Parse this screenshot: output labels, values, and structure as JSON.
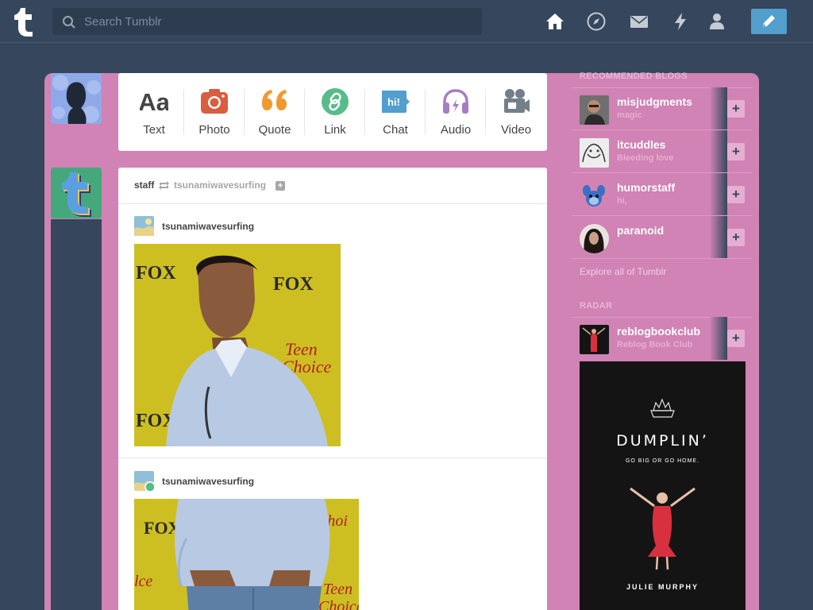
{
  "topbar": {
    "search_placeholder": "Search Tumblr",
    "nav_icons": [
      "home-icon",
      "compass-icon",
      "mail-icon",
      "lightning-icon",
      "account-icon"
    ],
    "compose_icon": "pencil-icon"
  },
  "colors": {
    "background": "#36465d",
    "frame_pink": "#d083b4",
    "accent_blue": "#529ecc"
  },
  "post_types": [
    {
      "label": "Text",
      "icon": "text-aa-icon",
      "color": "#444444"
    },
    {
      "label": "Photo",
      "icon": "camera-icon",
      "color": "#d95e40"
    },
    {
      "label": "Quote",
      "icon": "quote-icon",
      "color": "#f2992e"
    },
    {
      "label": "Link",
      "icon": "link-icon",
      "color": "#56bc8a"
    },
    {
      "label": "Chat",
      "icon": "chat-icon",
      "color": "#529ecc"
    },
    {
      "label": "Audio",
      "icon": "headphones-icon",
      "color": "#a77dc2"
    },
    {
      "label": "Video",
      "icon": "video-camera-icon",
      "color": "#748089"
    }
  ],
  "post": {
    "reblogger": "staff",
    "source": "tsunamiwavesurfing",
    "entries": [
      {
        "name": "tsunamiwavesurfing"
      },
      {
        "name": "tsunamiwavesurfing"
      }
    ]
  },
  "sidebar": {
    "recommended_heading": "RECOMMENDED BLOGS",
    "blogs": [
      {
        "name": "misjudgments",
        "subtitle": "magic"
      },
      {
        "name": "itcuddles",
        "subtitle": "Bleeding love"
      },
      {
        "name": "humorstaff",
        "subtitle": "hi,"
      },
      {
        "name": "paranoid",
        "subtitle": ""
      }
    ],
    "follow_label": "+",
    "explore_label": "Explore all of Tumblr",
    "radar_heading": "RADAR",
    "radar_blog": {
      "name": "reblogbookclub",
      "subtitle": "Reblog Book Club"
    },
    "book": {
      "title": "DUMPLIN’",
      "tagline": "GO BIG OR GO HOME.",
      "author": "JULIE MURPHY"
    }
  }
}
